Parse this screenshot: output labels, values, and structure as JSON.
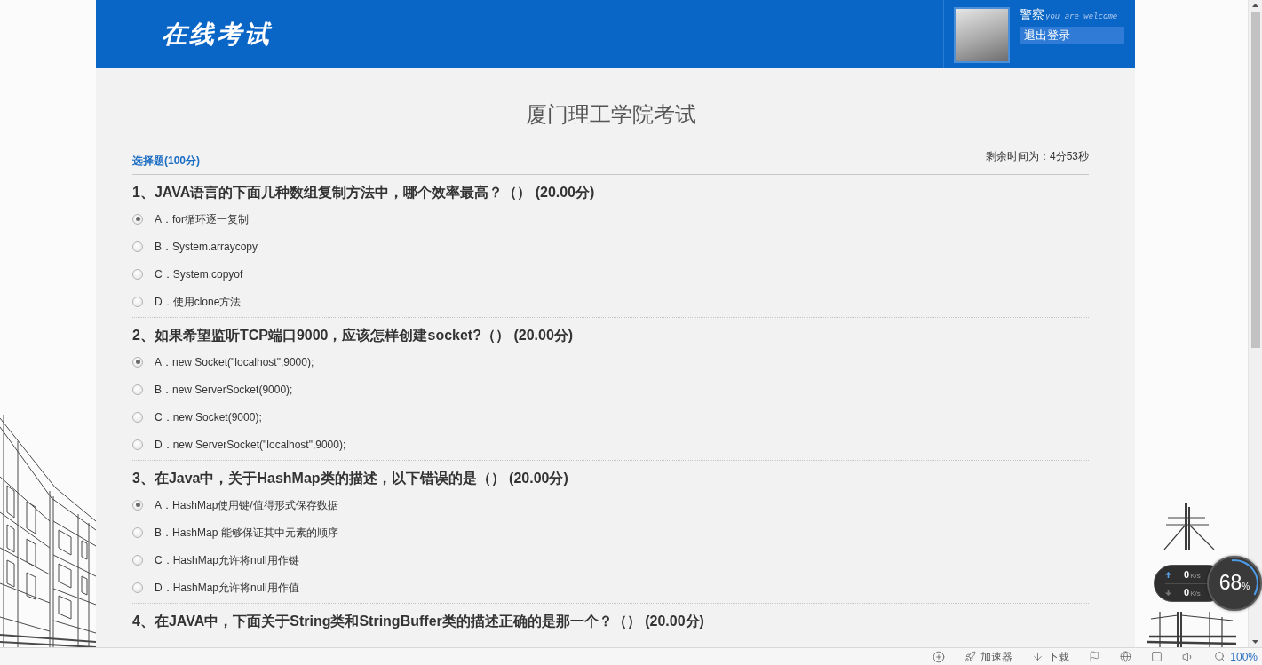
{
  "header": {
    "logo": "在线考试",
    "user_name": "警察",
    "greeting": "you are welcome",
    "logout": "退出登录"
  },
  "exam": {
    "title": "厦门理工学院考试",
    "section": "选择题(100分)",
    "timer": "剩余时间为：4分53秒"
  },
  "questions": [
    {
      "title": "1、JAVA语言的下面几种数组复制方法中，哪个效率最高？（） (20.00分)",
      "options": [
        {
          "label": "A．for循环逐一复制",
          "selected": true
        },
        {
          "label": "B．System.arraycopy",
          "selected": false
        },
        {
          "label": "C．System.copyof",
          "selected": false
        },
        {
          "label": "D．使用clone方法",
          "selected": false
        }
      ]
    },
    {
      "title": "2、如果希望监听TCP端口9000，应该怎样创建socket?（） (20.00分)",
      "options": [
        {
          "label": "A．new Socket(\"localhost\",9000);",
          "selected": true
        },
        {
          "label": "B．new ServerSocket(9000);",
          "selected": false
        },
        {
          "label": "C．new Socket(9000);",
          "selected": false
        },
        {
          "label": "D．new ServerSocket(\"localhost\",9000);",
          "selected": false
        }
      ]
    },
    {
      "title": "3、在Java中，关于HashMap类的描述，以下错误的是（） (20.00分)",
      "options": [
        {
          "label": "A．HashMap使用键/值得形式保存数据",
          "selected": true
        },
        {
          "label": "B．HashMap 能够保证其中元素的顺序",
          "selected": false
        },
        {
          "label": "C．HashMap允许将null用作键",
          "selected": false
        },
        {
          "label": "D．HashMap允许将null用作值",
          "selected": false
        }
      ]
    },
    {
      "title": "4、在JAVA中，下面关于String类和StringBuffer类的描述正确的是那一个？（） (20.00分)"
    }
  ],
  "speed_widget": {
    "upload": "0",
    "upload_unit": "K/s",
    "download": "0",
    "download_unit": "K/s",
    "percent": "68",
    "percent_sign": "%"
  },
  "status_bar": {
    "accelerator": "加速器",
    "download": "下载",
    "zoom": "100%"
  }
}
